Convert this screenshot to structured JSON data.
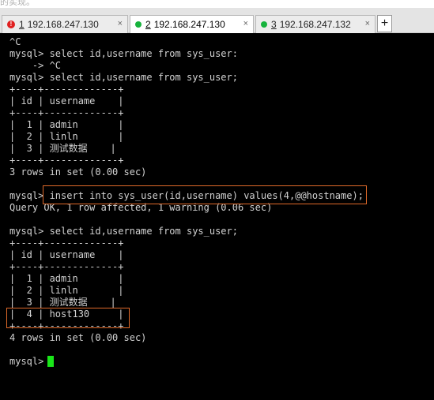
{
  "tabs": [
    {
      "number": "1",
      "host": "192.168.247.130",
      "status": "error",
      "active": false,
      "close": "×"
    },
    {
      "number": "2",
      "host": "192.168.247.130",
      "status": "connected",
      "active": true,
      "close": "×"
    },
    {
      "number": "3",
      "host": "192.168.247.132",
      "status": "connected",
      "active": false,
      "close": "×"
    }
  ],
  "add_tab_label": "+",
  "background_partial_text": "的实现。",
  "terminal": {
    "lines": [
      "^C",
      "mysql> select id,username from sys_user:",
      "    -> ^C",
      "mysql> select id,username from sys_user;",
      "+----+-------------+",
      "| id | username    |",
      "+----+-------------+",
      "|  1 | admin       |",
      "|  2 | linln       |",
      "|  3 | 测试数据    |",
      "+----+-------------+",
      "3 rows in set (0.00 sec)",
      "",
      "mysql> insert into sys_user(id,username) values(4,@@hostname);",
      "Query OK, 1 row affected, 1 warning (0.06 sec)",
      "",
      "mysql> select id,username from sys_user;",
      "+----+-------------+",
      "| id | username    |",
      "+----+-------------+",
      "|  1 | admin       |",
      "|  2 | linln       |",
      "|  3 | 测试数据    |",
      "|  4 | host130     |",
      "+----+-------------+",
      "4 rows in set (0.00 sec)",
      "",
      "mysql> "
    ]
  },
  "colors": {
    "terminal_bg": "#000000",
    "terminal_fg": "#d2d2d2",
    "cursor": "#19e619",
    "highlight_box": "#e06a2a",
    "status_error": "#e02020",
    "status_ok": "#17b33d"
  }
}
